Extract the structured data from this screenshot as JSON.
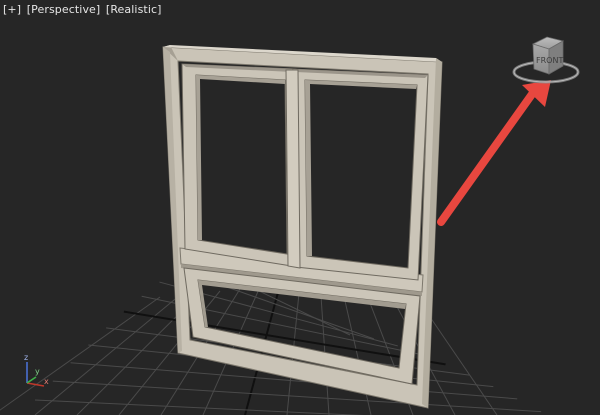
{
  "viewport": {
    "labels": {
      "menu": "[+]",
      "view": "[Perspective]",
      "shading": "[Realistic]"
    },
    "view_cube": {
      "face_label": "FRONT"
    },
    "axis_tripod": {
      "z": "z",
      "x": "x",
      "y": "y"
    }
  },
  "colors": {
    "viewport_bg": "#262626",
    "grid_line": "#4a4a4a",
    "grid_center": "#101010",
    "window_frame": "#c9c3b6",
    "annotation_arrow": "#e8473f",
    "axis_x": "#c0392b",
    "axis_y": "#3fb04a",
    "axis_z": "#4a6fd1"
  },
  "icons": {
    "view_cube": "view-cube-icon",
    "axis_tripod": "axis-tripod-icon",
    "annotation": "red-arrow"
  }
}
